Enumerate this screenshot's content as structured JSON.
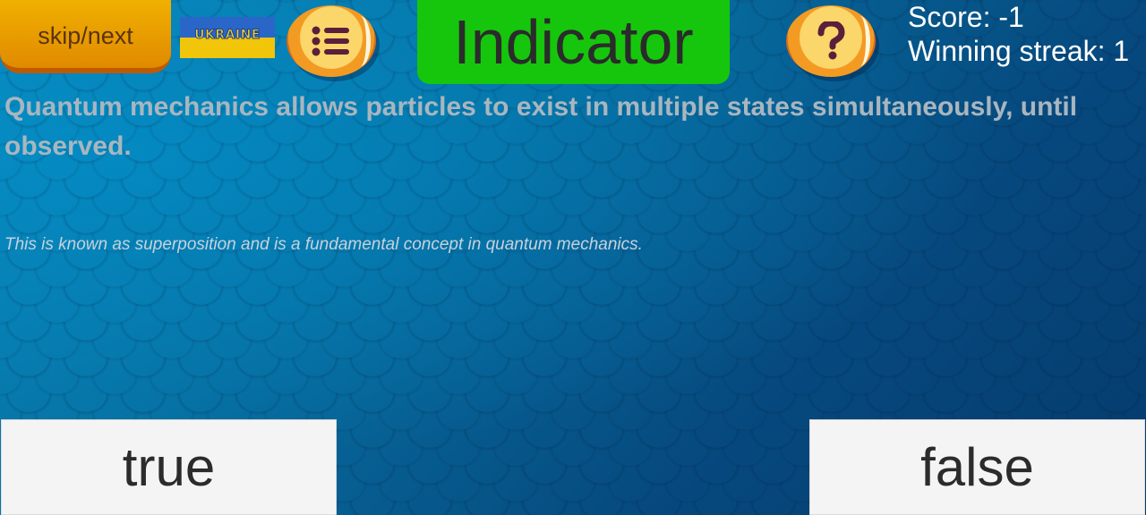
{
  "header": {
    "skip_label": "skip/next",
    "flag_label": "UKRAINE",
    "title": "Indicator",
    "score_text": "Score: -1",
    "streak_text": "Winning streak: 1"
  },
  "icons": {
    "menu": "list-icon",
    "help": "question-icon"
  },
  "question": {
    "statement": "Quantum mechanics allows particles to exist in multiple states simultaneously, until observed.",
    "explanation": "This is known as superposition and is a fundamental concept in quantum mechanics."
  },
  "answers": {
    "true_label": "true",
    "false_label": "false"
  },
  "colors": {
    "indicator": "#16c60c",
    "skip_button": "#f0b000",
    "background": "#076ea0"
  }
}
